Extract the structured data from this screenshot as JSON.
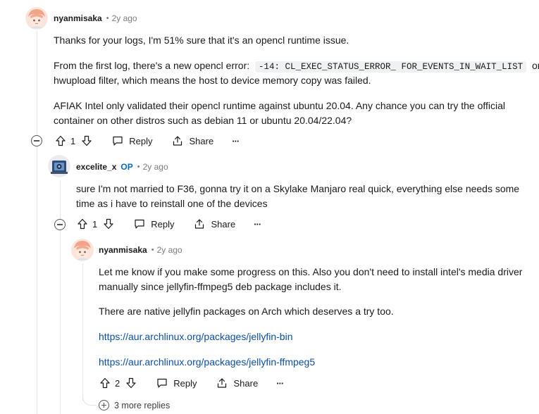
{
  "comments": [
    {
      "author": "nyanmisaka",
      "age": "2y ago",
      "paragraphs": {
        "p1": "Thanks for your logs, I'm 51% sure that it's an opencl runtime issue.",
        "p2_pre": "From the first log, there's a new opencl error:",
        "p2_code": "-14: CL_EXEC_STATUS_ERROR_ FOR_EVENTS_IN_WAIT_LIST",
        "p2_post": "on",
        "p2_line2": "hwupload filter, which means the host to device memory copy was failed.",
        "p3_line1": "AFIAK Intel only validated their opencl runtime against ubuntu 20.04. Any chance you can try the official",
        "p3_line2": "container on other distros such as debian 11 or ubuntu 20.04/22.04?"
      },
      "votes": "1",
      "reply_label": "Reply",
      "share_label": "Share",
      "more_label": "···"
    },
    {
      "author": "excelite_x",
      "op_badge": "OP",
      "age": "2y ago",
      "paragraphs": {
        "line1": "sure I'm not married to F36, gonna try it on a Skylake Manjaro real quick, everything else needs some",
        "line2": "time as i have to reinstall one of the devices"
      },
      "votes": "1",
      "reply_label": "Reply",
      "share_label": "Share",
      "more_label": "···"
    },
    {
      "author": "nyanmisaka",
      "age": "2y ago",
      "paragraphs": {
        "p1_line1": "Let me know if you make some progress on this. Also you don't need to install intel's media driver",
        "p1_line2": "manually since jellyfin-ffmpeg5 deb package includes it.",
        "p2": "There are native jellyfin packages on Arch which deserves a try too.",
        "link1": "https://aur.archlinux.org/packages/jellyfin-bin",
        "link2": "https://aur.archlinux.org/packages/jellyfin-ffmpeg5"
      },
      "votes": "2",
      "reply_label": "Reply",
      "share_label": "Share",
      "more_label": "···"
    }
  ],
  "more_replies": "3 more replies",
  "colors": {
    "link": "#0b4fa3",
    "op": "#0a66c2",
    "muted": "#7c7c7c",
    "thread_line": "#e2e4e6"
  },
  "icons": [
    "upvote-icon",
    "downvote-icon",
    "comment-icon",
    "share-icon",
    "overflow-icon",
    "collapse-icon",
    "expand-icon"
  ]
}
